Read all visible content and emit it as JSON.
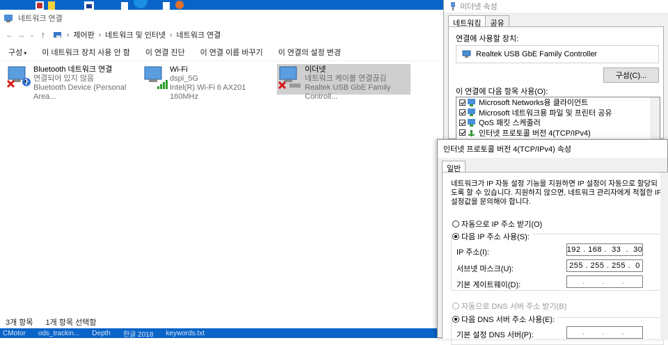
{
  "explorer": {
    "window_title": "네트워크 연결",
    "breadcrumb": [
      "제어판",
      "네트워크 및 인터넷",
      "네트워크 연결"
    ],
    "commands": [
      "구성",
      "이 네트워크 장치 사용 안 함",
      "이 연결 진단",
      "이 연결 이름 바꾸기",
      "이 연결의 설정 변경"
    ],
    "connections": [
      {
        "name": "Bluetooth 네트워크 연결",
        "status": "연결되어 있지 않음",
        "device": "Bluetooth Device (Personal Area..."
      },
      {
        "name": "Wi-Fi",
        "status": "dspl_5G",
        "device": "Intel(R) Wi-Fi 6 AX201 160MHz"
      },
      {
        "name": "이더넷",
        "status": "네트워크 케이블 연결끊김",
        "device": "Realtek USB GbE Family Controll..."
      }
    ],
    "status": {
      "count": "3개 항목",
      "selected": "1개 항목 선택함"
    }
  },
  "taskbar": {
    "items": [
      "CMotor",
      "ods_trackin...",
      "Depth",
      "한글 2018",
      "keywords.txt"
    ]
  },
  "ethernet_props": {
    "title": "이더넷 속성",
    "tabs": [
      "네트워킹",
      "공유"
    ],
    "connect_using_label": "연결에 사용할 장치:",
    "device_name": "Realtek USB GbE Family Controller",
    "configure_button": "구성(C)...",
    "items_label": "이 연결에 다음 항목 사용(O):",
    "items": [
      "Microsoft Networks용 클라이언트",
      "Microsoft 네트워크용 파일 및 프린터 공유",
      "QoS 패킷 스케줄러",
      "인터넷 프로토콜 버전 4(TCP/IPv4)"
    ]
  },
  "ipv4_props": {
    "title": "인터넷 프로토콜 버전 4(TCP/IPv4) 속성",
    "tab": "일반",
    "description": "네트워크가 IP 자동 설정 기능을 지원하면 IP 설정이 자동으로 할당되도록 할 수 있습니다. 지원하지 않으면, 네트워크 관리자에게 적절한 IP 설정값을 문의해야 합니다.",
    "auto_ip_label": "자동으로 IP 주소 받기(O)",
    "manual_ip_label": "다음 IP 주소 사용(S):",
    "ip_label": "IP 주소(I):",
    "ip_value": "192 . 168 .  33  .  30",
    "subnet_label": "서브넷 마스크(U):",
    "subnet_value": "255 . 255 . 255 .  0",
    "gateway_label": "기본 게이트웨이(D):",
    "gateway_value": " .       .       .  ",
    "auto_dns_label": "자동으로 DNS 서버 주소 받기(B)",
    "manual_dns_label": "다음 DNS 서버 주소 사용(E):",
    "pref_dns_label": "기본 설정 DNS 서버(P):",
    "pref_dns_value": " .       .       .  "
  }
}
